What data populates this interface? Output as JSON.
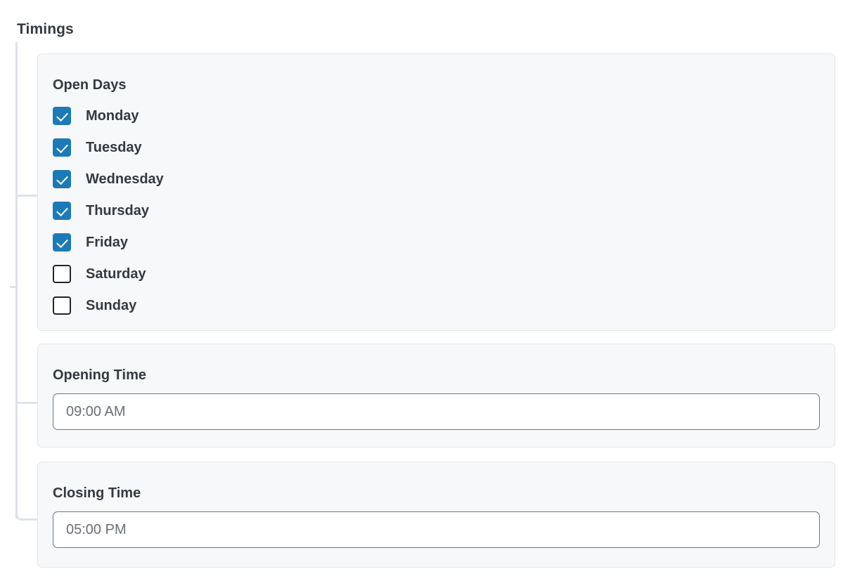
{
  "section": {
    "title": "Timings"
  },
  "theme": {
    "checkbox_checked_color": "#1d7ab8",
    "checkbox_unchecked_border": "#21262c",
    "card_background": "#f6f8fa",
    "card_border": "#e3e7eb",
    "text_color": "#343a40",
    "input_border": "#6e7781",
    "input_text": "#6b7076",
    "tree_line": "#dfe3e8"
  },
  "open_days": {
    "label": "Open Days",
    "days": [
      {
        "label": "Monday",
        "checked": true
      },
      {
        "label": "Tuesday",
        "checked": true
      },
      {
        "label": "Wednesday",
        "checked": true
      },
      {
        "label": "Thursday",
        "checked": true
      },
      {
        "label": "Friday",
        "checked": true
      },
      {
        "label": "Saturday",
        "checked": false
      },
      {
        "label": "Sunday",
        "checked": false
      }
    ]
  },
  "opening_time": {
    "label": "Opening Time",
    "value": "",
    "placeholder": "09:00 AM"
  },
  "closing_time": {
    "label": "Closing Time",
    "value": "",
    "placeholder": "05:00 PM"
  }
}
